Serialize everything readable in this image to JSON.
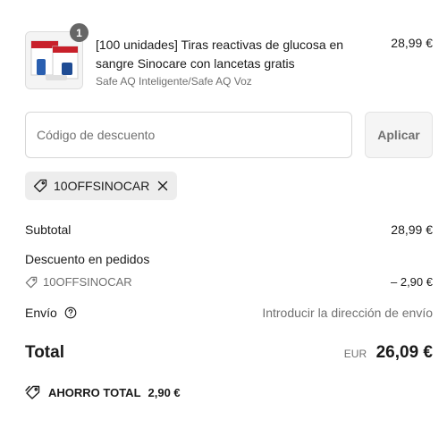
{
  "product": {
    "quantity": "1",
    "title": "[100 unidades] Tiras reactivas de glucosa en sangre Sinocare con lancetas gratis",
    "variant": "Safe AQ Inteligente/Safe AQ Voz",
    "price": "28,99 €"
  },
  "discount": {
    "placeholder": "Código de descuento",
    "value": "",
    "apply_label": "Aplicar",
    "applied_code": "10OFFSINOCAR"
  },
  "summary": {
    "subtotal_label": "Subtotal",
    "subtotal_value": "28,99 €",
    "order_discount_label": "Descuento en pedidos",
    "order_discount_code": "10OFFSINOCAR",
    "order_discount_value": "– 2,90 €",
    "shipping_label": "Envío",
    "shipping_value": "Introducir la dirección de envío",
    "total_label": "Total",
    "currency": "EUR",
    "total_value": "26,09 €",
    "savings_label": "AHORRO TOTAL",
    "savings_value": "2,90 €"
  },
  "colors": {
    "text": "#1a1a1a",
    "muted": "#707070",
    "badge": "#666666",
    "chip_bg": "#ededed"
  },
  "icons": [
    "tag-icon",
    "close-icon",
    "help-icon",
    "savings-tag-icon"
  ]
}
